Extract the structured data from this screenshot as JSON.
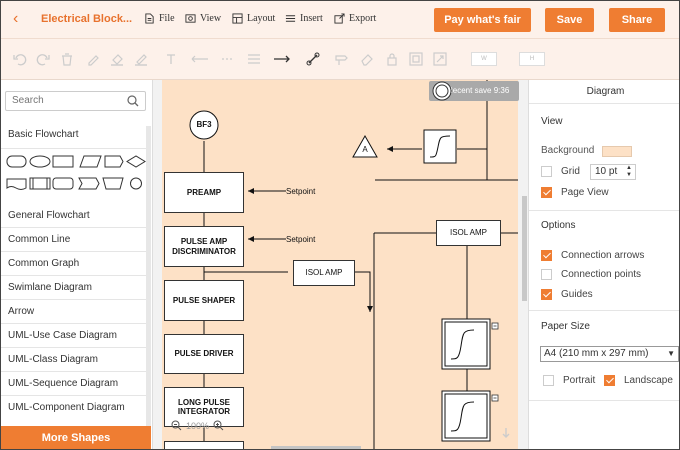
{
  "header": {
    "doc_title": "Electrical Block...",
    "menu": [
      "File",
      "View",
      "Layout",
      "Insert",
      "Export"
    ],
    "buttons": {
      "pay": "Pay what's fair",
      "save": "Save",
      "share": "Share"
    }
  },
  "sidebar": {
    "search_placeholder": "Search",
    "first_category": "Basic Flowchart",
    "categories": [
      "General Flowchart",
      "Common Line",
      "Common Graph",
      "Swimlane Diagram",
      "Arrow",
      "UML-Use Case Diagram",
      "UML-Class Diagram",
      "UML-Sequence Diagram",
      "UML-Component Diagram"
    ],
    "more": "More Shapes"
  },
  "canvas": {
    "recent_save": "Recent save 9:36",
    "zoom": "100%",
    "nodes": {
      "bf3": "BF3",
      "triangle": "A",
      "preamp": "PREAMP",
      "pulse_amp": "PULSE AMP DISCRIMINATOR",
      "isol_amp_1": "ISOL AMP",
      "isol_amp_2": "ISOL AMP",
      "pulse_shaper": "PULSE SHAPER",
      "pulse_driver": "PULSE DRIVER",
      "long_pulse": "LONG PULSE INTEGRATOR"
    },
    "setpoint_1": "Setpoint",
    "setpoint_2": "Setpoint"
  },
  "panel": {
    "title": "Diagram",
    "view": {
      "heading": "View",
      "background": "Background",
      "background_color": "#fde1c6",
      "grid": "Grid",
      "grid_checked": false,
      "grid_size": "10 pt",
      "page_view": "Page View",
      "page_view_checked": true
    },
    "options": {
      "heading": "Options",
      "connection_arrows": "Connection arrows",
      "connection_points": "Connection points",
      "guides": "Guides"
    },
    "paper": {
      "heading": "Paper Size",
      "size": "A4 (210 mm x 297 mm)",
      "portrait": "Portrait",
      "landscape": "Landscape"
    }
  },
  "colors": {
    "accent": "#ef7d32",
    "canvas": "#fde1c6",
    "toolbar": "#fdf1ea"
  }
}
